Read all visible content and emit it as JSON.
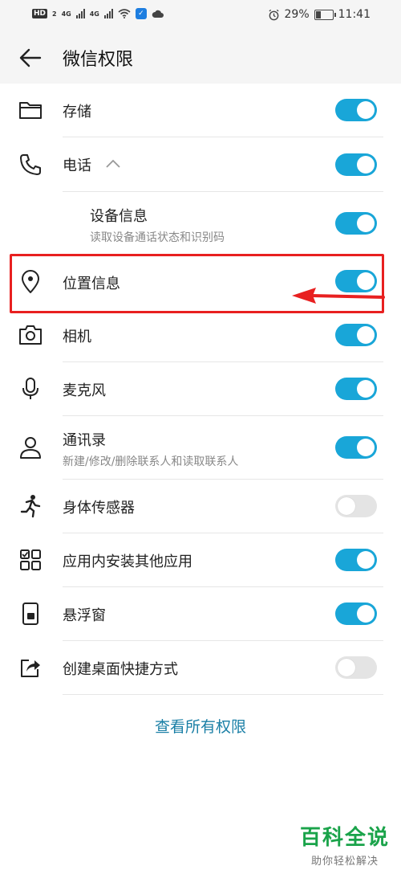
{
  "status_bar": {
    "hd_badge": "HD",
    "hd_sub": "2",
    "signal1_label": "4G",
    "signal2_label": "4G",
    "battery_percent": "29%",
    "battery_level": 0.29,
    "time": "11:41"
  },
  "header": {
    "title": "微信权限"
  },
  "permissions": [
    {
      "label": "存储",
      "icon": "folder-icon",
      "enabled": true
    },
    {
      "label": "电话",
      "icon": "phone-icon",
      "enabled": true,
      "expanded": true
    },
    {
      "label": "设备信息",
      "sub": "读取设备通话状态和识别码",
      "enabled": true
    },
    {
      "label": "位置信息",
      "icon": "location-pin-icon",
      "enabled": true,
      "highlighted": true
    },
    {
      "label": "相机",
      "icon": "camera-icon",
      "enabled": true
    },
    {
      "label": "麦克风",
      "icon": "microphone-icon",
      "enabled": true
    },
    {
      "label": "通讯录",
      "sub": "新建/修改/删除联系人和读取联系人",
      "icon": "contacts-icon",
      "enabled": true
    },
    {
      "label": "身体传感器",
      "icon": "running-person-icon",
      "enabled": false
    },
    {
      "label": "应用内安装其他应用",
      "icon": "apps-grid-icon",
      "enabled": true
    },
    {
      "label": "悬浮窗",
      "icon": "floating-window-icon",
      "enabled": true
    },
    {
      "label": "创建桌面快捷方式",
      "icon": "share-shortcut-icon",
      "enabled": false
    }
  ],
  "footer": {
    "view_all_label": "查看所有权限"
  },
  "watermark": {
    "title": "百科全说",
    "subtitle": "助你轻松解决"
  },
  "colors": {
    "toggle_on": "#19a6d8",
    "toggle_off": "#e4e4e4",
    "highlight": "#e82020",
    "link": "#1a7fa6"
  }
}
